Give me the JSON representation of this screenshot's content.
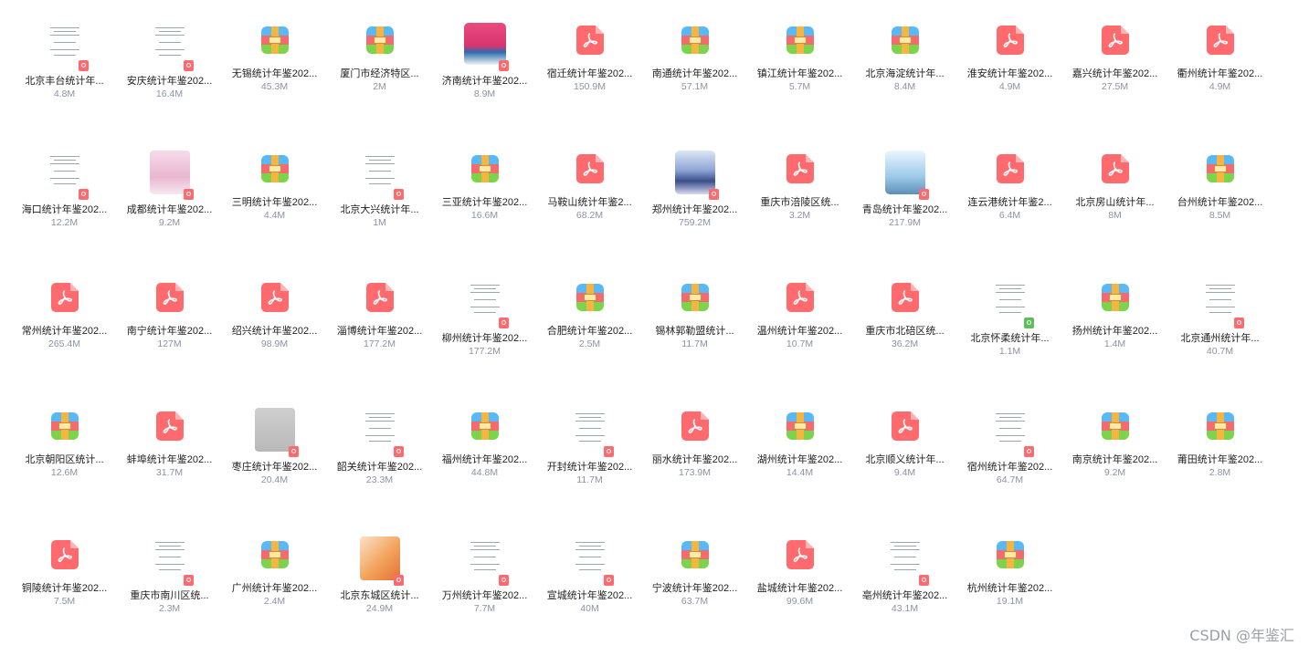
{
  "files": [
    [
      {
        "name": "北京丰台统计年...",
        "size": "4.8M",
        "type": "doc"
      },
      {
        "name": "安庆统计年鉴202...",
        "size": "16.4M",
        "type": "doc"
      },
      {
        "name": "无锡统计年鉴202...",
        "size": "45.3M",
        "type": "zip"
      },
      {
        "name": "厦门市经济特区...",
        "size": "2M",
        "type": "zip"
      },
      {
        "name": "济南统计年鉴202...",
        "size": "8.9M",
        "type": "doc-color-a"
      },
      {
        "name": "宿迁统计年鉴202...",
        "size": "150.9M",
        "type": "pdf"
      },
      {
        "name": "南通统计年鉴202...",
        "size": "57.1M",
        "type": "zip"
      },
      {
        "name": "镇江统计年鉴202...",
        "size": "5.7M",
        "type": "zip"
      },
      {
        "name": "北京海淀统计年...",
        "size": "8.4M",
        "type": "zip"
      },
      {
        "name": "淮安统计年鉴202...",
        "size": "4.9M",
        "type": "pdf"
      },
      {
        "name": "嘉兴统计年鉴202...",
        "size": "27.5M",
        "type": "pdf"
      },
      {
        "name": "衢州统计年鉴202...",
        "size": "4.9M",
        "type": "pdf"
      }
    ],
    [
      {
        "name": "海口统计年鉴202...",
        "size": "12.2M",
        "type": "doc"
      },
      {
        "name": "成都统计年鉴202...",
        "size": "9.2M",
        "type": "doc-color-b"
      },
      {
        "name": "三明统计年鉴202...",
        "size": "4.4M",
        "type": "zip"
      },
      {
        "name": "北京大兴统计年...",
        "size": "1M",
        "type": "doc"
      },
      {
        "name": "三亚统计年鉴202...",
        "size": "16.6M",
        "type": "zip"
      },
      {
        "name": "马鞍山统计年鉴2...",
        "size": "68.2M",
        "type": "pdf"
      },
      {
        "name": "郑州统计年鉴202...",
        "size": "759.2M",
        "type": "doc-color-c"
      },
      {
        "name": "重庆市涪陵区统...",
        "size": "3.2M",
        "type": "pdf"
      },
      {
        "name": "青岛统计年鉴202...",
        "size": "217.9M",
        "type": "doc-color-d"
      },
      {
        "name": "连云港统计年鉴2...",
        "size": "6.4M",
        "type": "pdf"
      },
      {
        "name": "北京房山统计年...",
        "size": "8M",
        "type": "pdf"
      },
      {
        "name": "台州统计年鉴202...",
        "size": "8.5M",
        "type": "zip"
      }
    ],
    [
      {
        "name": "常州统计年鉴202...",
        "size": "265.4M",
        "type": "pdf"
      },
      {
        "name": "南宁统计年鉴202...",
        "size": "127M",
        "type": "pdf"
      },
      {
        "name": "绍兴统计年鉴202...",
        "size": "98.9M",
        "type": "pdf"
      },
      {
        "name": "淄博统计年鉴202...",
        "size": "177.2M",
        "type": "pdf"
      },
      {
        "name": "柳州统计年鉴202...",
        "size": "177.2M",
        "type": "doc"
      },
      {
        "name": "合肥统计年鉴202...",
        "size": "2.5M",
        "type": "zip"
      },
      {
        "name": "锡林郭勒盟统计...",
        "size": "11.7M",
        "type": "zip"
      },
      {
        "name": "温州统计年鉴202...",
        "size": "10.7M",
        "type": "pdf"
      },
      {
        "name": "重庆市北碚区统...",
        "size": "36.2M",
        "type": "pdf"
      },
      {
        "name": "北京怀柔统计年...",
        "size": "1.1M",
        "type": "doc-xls"
      },
      {
        "name": "扬州统计年鉴202...",
        "size": "1.4M",
        "type": "zip"
      },
      {
        "name": "北京通州统计年...",
        "size": "40.7M",
        "type": "doc"
      }
    ],
    [
      {
        "name": "北京朝阳区统计...",
        "size": "12.6M",
        "type": "zip"
      },
      {
        "name": "蚌埠统计年鉴202...",
        "size": "31.7M",
        "type": "pdf"
      },
      {
        "name": "枣庄统计年鉴202...",
        "size": "20.4M",
        "type": "doc-color-e"
      },
      {
        "name": "韶关统计年鉴202...",
        "size": "23.3M",
        "type": "doc"
      },
      {
        "name": "福州统计年鉴202...",
        "size": "44.8M",
        "type": "zip"
      },
      {
        "name": "开封统计年鉴202...",
        "size": "11.7M",
        "type": "doc"
      },
      {
        "name": "丽水统计年鉴202...",
        "size": "173.9M",
        "type": "pdf"
      },
      {
        "name": "湖州统计年鉴202...",
        "size": "14.4M",
        "type": "zip"
      },
      {
        "name": "北京顺义统计年...",
        "size": "9.4M",
        "type": "pdf"
      },
      {
        "name": "宿州统计年鉴202...",
        "size": "64.7M",
        "type": "doc"
      },
      {
        "name": "南京统计年鉴202...",
        "size": "9.2M",
        "type": "zip"
      },
      {
        "name": "莆田统计年鉴202...",
        "size": "2.8M",
        "type": "zip"
      }
    ],
    [
      {
        "name": "铜陵统计年鉴202...",
        "size": "7.5M",
        "type": "pdf"
      },
      {
        "name": "重庆市南川区统...",
        "size": "2.3M",
        "type": "doc"
      },
      {
        "name": "广州统计年鉴202...",
        "size": "2.4M",
        "type": "zip"
      },
      {
        "name": "北京东城区统计...",
        "size": "24.9M",
        "type": "doc-color-f"
      },
      {
        "name": "万州统计年鉴202...",
        "size": "7.7M",
        "type": "doc"
      },
      {
        "name": "宣城统计年鉴202...",
        "size": "40M",
        "type": "doc"
      },
      {
        "name": "宁波统计年鉴202...",
        "size": "63.7M",
        "type": "zip"
      },
      {
        "name": "盐城统计年鉴202...",
        "size": "99.6M",
        "type": "pdf"
      },
      {
        "name": "亳州统计年鉴202...",
        "size": "43.1M",
        "type": "doc"
      },
      {
        "name": "杭州统计年鉴202...",
        "size": "19.1M",
        "type": "zip"
      }
    ]
  ],
  "watermark": "CSDN @年鉴汇"
}
